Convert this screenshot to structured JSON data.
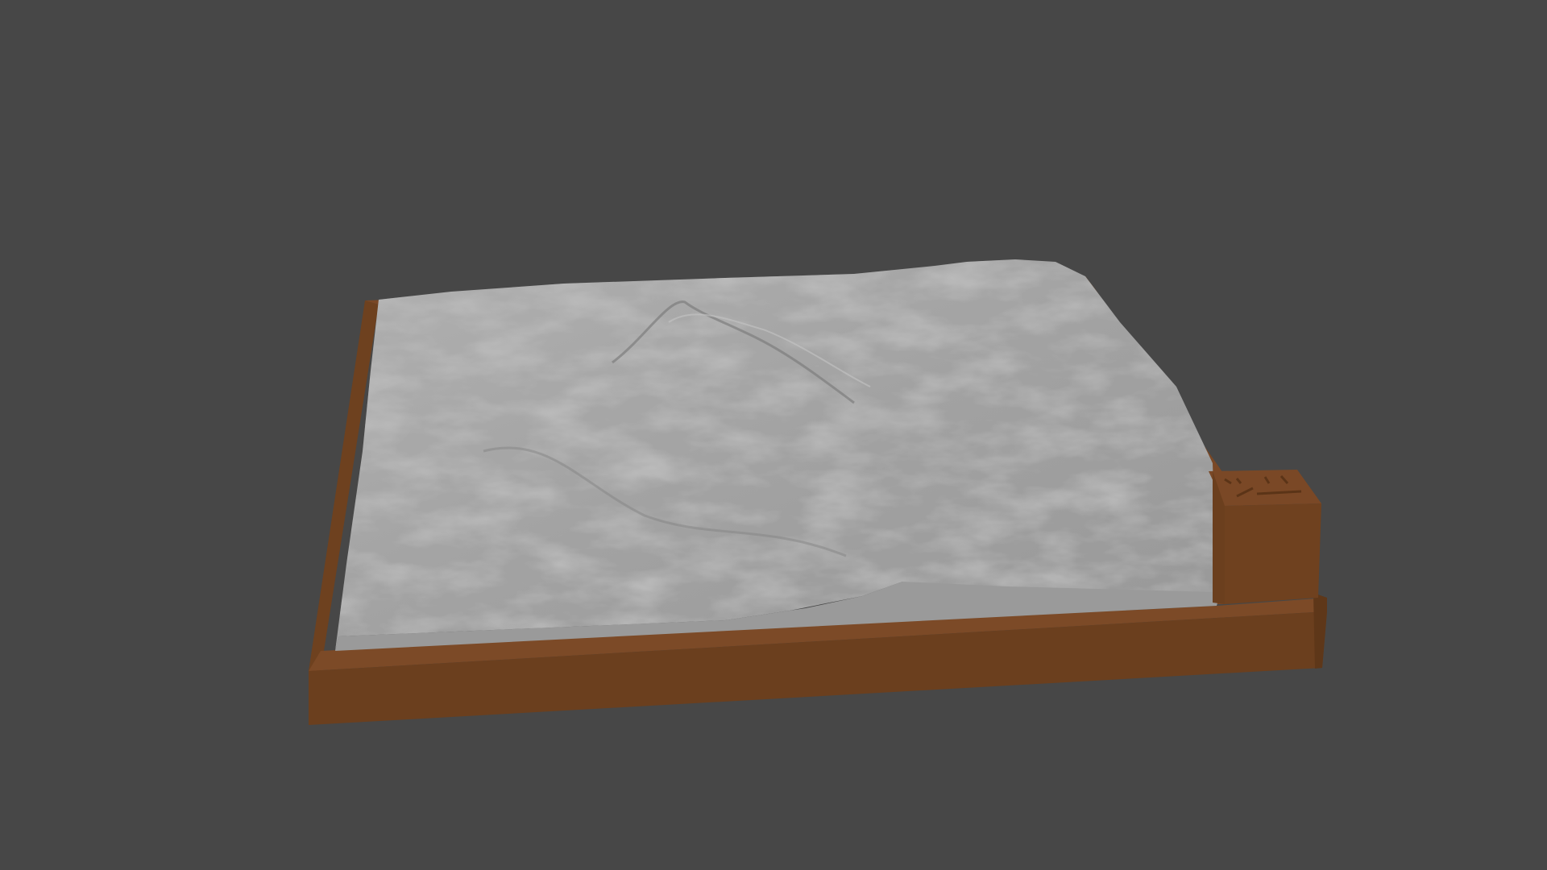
{
  "scene": {
    "colors": {
      "background": "#474747",
      "base_front": "#6b3f1e",
      "base_top": "#7a4826",
      "base_side": "#5e3719",
      "terrain": "#a6a6a6",
      "terrain_shadow": "#8a8a8a",
      "terrain_flat": "#9c9c9c"
    }
  }
}
